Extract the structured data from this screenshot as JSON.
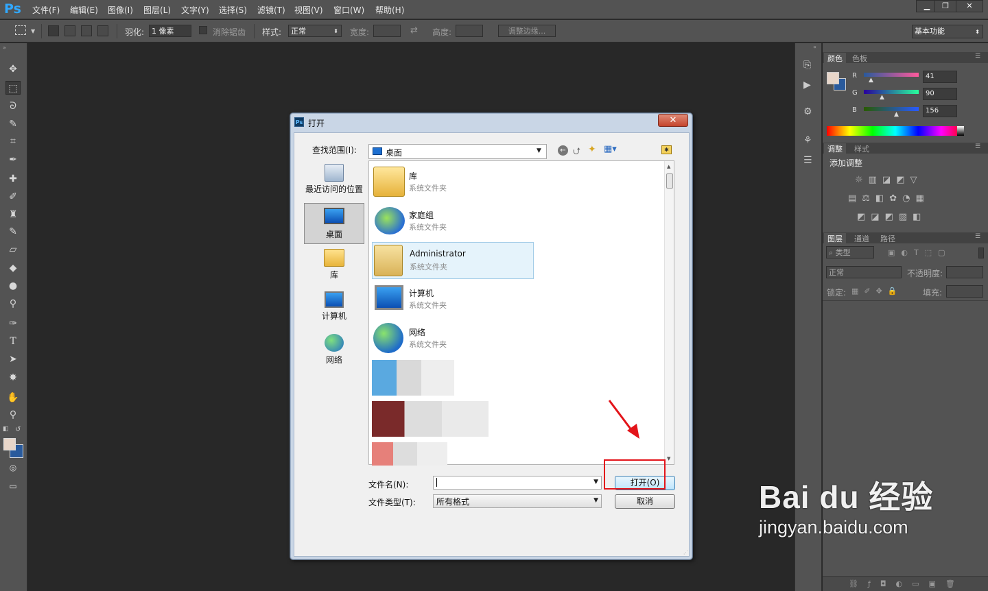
{
  "app": {
    "logo": "Ps"
  },
  "menubar": {
    "items": [
      "文件(F)",
      "编辑(E)",
      "图像(I)",
      "图层(L)",
      "文字(Y)",
      "选择(S)",
      "滤镜(T)",
      "视图(V)",
      "窗口(W)",
      "帮助(H)"
    ],
    "window_buttons": [
      "▁",
      "❐",
      "✕"
    ]
  },
  "options_bar": {
    "feather_label": "羽化:",
    "feather_value": "1 像素",
    "antialias_label": "消除锯齿",
    "style_label": "样式:",
    "style_value": "正常",
    "width_label": "宽度:",
    "height_label": "高度:",
    "refine_edge": "调整边缘...",
    "workspace": "基本功能"
  },
  "panels": {
    "color_tabs": [
      "颜色",
      "色板"
    ],
    "rgb": {
      "r_label": "R",
      "g_label": "G",
      "b_label": "B",
      "r": "41",
      "g": "90",
      "b": "156"
    },
    "adjust_tabs": [
      "调整",
      "样式"
    ],
    "adjust_title": "添加调整",
    "layers_tabs": [
      "图层",
      "通道",
      "路径"
    ],
    "filter_label": "类型",
    "blend_mode": "正常",
    "opacity_label": "不透明度:",
    "lock_label": "锁定:",
    "fill_label": "填充:"
  },
  "dialog": {
    "title": "打开",
    "look_in_label": "查找范围(I):",
    "look_in_value": "桌面",
    "places": [
      {
        "label": "最近访问的位置",
        "icon": "recent-places-icon"
      },
      {
        "label": "桌面",
        "icon": "desktop-icon"
      },
      {
        "label": "库",
        "icon": "library-icon"
      },
      {
        "label": "计算机",
        "icon": "computer-icon"
      },
      {
        "label": "网络",
        "icon": "network-icon"
      }
    ],
    "files": [
      {
        "name": "库",
        "type": "系统文件夹",
        "icon": "library-icon"
      },
      {
        "name": "家庭组",
        "type": "系统文件夹",
        "icon": "homegroup-icon"
      },
      {
        "name": "Administrator",
        "type": "系统文件夹",
        "icon": "user-folder-icon"
      },
      {
        "name": "计算机",
        "type": "系统文件夹",
        "icon": "computer-icon"
      },
      {
        "name": "网络",
        "type": "系统文件夹",
        "icon": "network-icon"
      }
    ],
    "filename_label": "文件名(N):",
    "filename_value": "",
    "filetype_label": "文件类型(T):",
    "filetype_value": "所有格式",
    "open_button": "打开(O)",
    "cancel_button": "取消"
  },
  "watermark": {
    "brand": "Bai du 经验",
    "url": "jingyan.baidu.com"
  }
}
